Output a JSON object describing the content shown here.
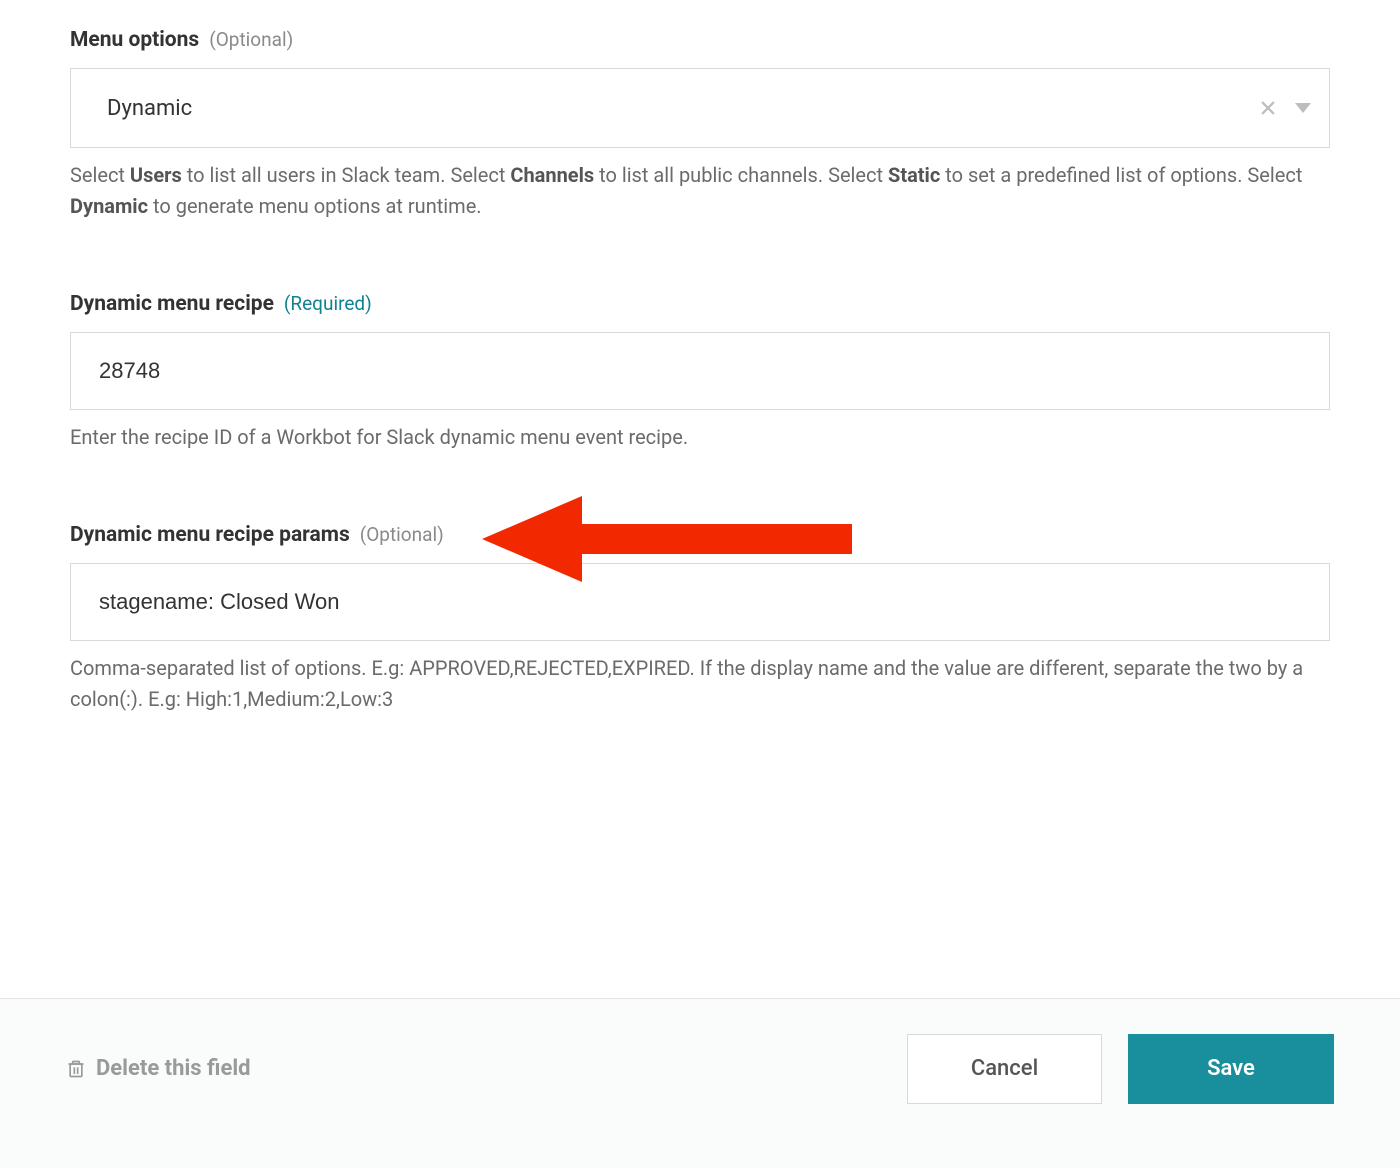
{
  "menu_options": {
    "label": "Menu options",
    "hint": "(Optional)",
    "value": "Dynamic",
    "help_parts": {
      "p1": "Select ",
      "b1": "Users",
      "p2": " to list all users in Slack team. Select ",
      "b2": "Channels",
      "p3": " to list all public channels. Select ",
      "b3": "Static",
      "p4": " to set a predefined list of options. Select ",
      "b4": "Dynamic",
      "p5": " to generate menu options at runtime."
    }
  },
  "dynamic_recipe": {
    "label": "Dynamic menu recipe",
    "hint": "(Required)",
    "value": "28748",
    "help": "Enter the recipe ID of a Workbot for Slack dynamic menu event recipe."
  },
  "dynamic_params": {
    "label": "Dynamic menu recipe params",
    "hint": "(Optional)",
    "value": "stagename: Closed Won",
    "help": "Comma-separated list of options. E.g: APPROVED,REJECTED,EXPIRED. If the display name and the value are different, separate the two by a colon(:). E.g: High:1,Medium:2,Low:3"
  },
  "footer": {
    "delete": "Delete this field",
    "cancel": "Cancel",
    "save": "Save"
  }
}
